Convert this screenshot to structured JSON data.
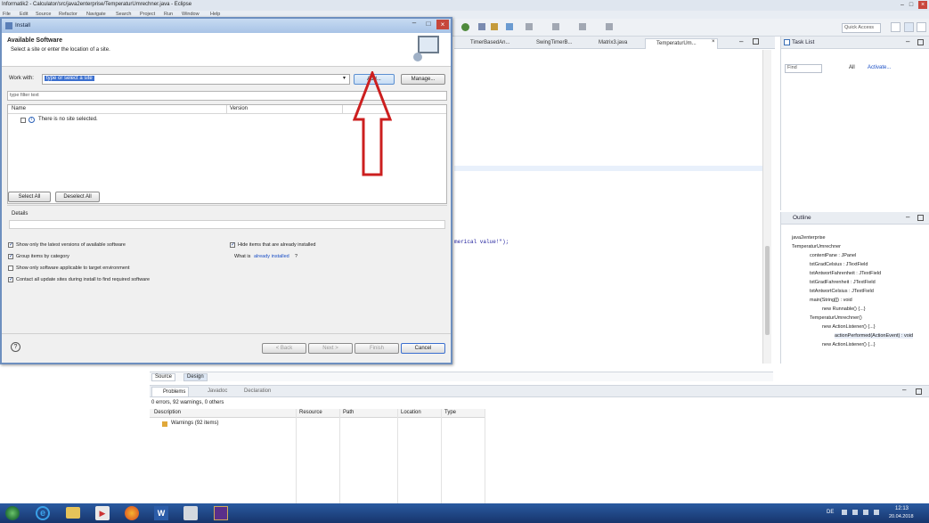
{
  "window": {
    "title": "Informatik2 - Calculator/src/java2enterprise/TemperaturUmrechner.java - Eclipse",
    "menu": [
      "File",
      "Edit",
      "Source",
      "Refactor",
      "Navigate",
      "Search",
      "Project",
      "Run",
      "Window",
      "Help"
    ],
    "quick_access": "Quick Access"
  },
  "editor": {
    "tabs": [
      "TimerBasedAn...",
      "SwingTimerB...",
      "Matrix3.java",
      "TemperaturUm..."
    ],
    "code_fragment": "merical value!\");",
    "bottom_tabs": [
      "Source",
      "Design"
    ]
  },
  "tasklist": {
    "title": "Task List",
    "find_placeholder": "Find",
    "all_label": "All",
    "activate_label": "Activate..."
  },
  "outline": {
    "title": "Outline",
    "items": [
      "java2enterprise",
      "TemperaturUmrechner",
      "contentPane : JPanel",
      "txtGradCelsius : JTextField",
      "txtAntwortFahrenheit : JTextField",
      "txtGradFahrenheit : JTextField",
      "txtAntwortCelsius : JTextField",
      "main(String[]) : void",
      "new Runnable() {...}",
      "TemperaturUmrechner()",
      "new ActionListener() {...}",
      "actionPerformed(ActionEvent) : void",
      "new ActionListener() {...}"
    ]
  },
  "problems": {
    "tabs": [
      "Problems",
      "Javadoc",
      "Declaration"
    ],
    "summary": "0 errors, 92 warnings, 0 others",
    "columns": [
      "Description",
      "Resource",
      "Path",
      "Location",
      "Type"
    ],
    "row": "Warnings (92 items)"
  },
  "dialog": {
    "title": "Install",
    "header_title": "Available Software",
    "header_subtitle": "Select a site or enter the location of a site.",
    "work_with_label": "Work with:",
    "work_with_value": "type or select a site",
    "add_button": "Add...",
    "manage_button": "Manage...",
    "filter_placeholder": "type filter text",
    "columns": [
      "Name",
      "Version"
    ],
    "no_site_text": "There is no site selected.",
    "select_all": "Select All",
    "deselect_all": "Deselect All",
    "details_label": "Details",
    "options_left": [
      {
        "label": "Show only the latest versions of available software",
        "checked": true
      },
      {
        "label": "Group items by category",
        "checked": true
      },
      {
        "label": "Show only software applicable to target environment",
        "checked": false
      },
      {
        "label": "Contact all update sites during install to find required software",
        "checked": true
      }
    ],
    "options_right": [
      {
        "label": "Hide items that are already installed",
        "checked": true
      }
    ],
    "what_is_prefix": "What is ",
    "what_is_link": "already installed",
    "what_is_suffix": "?",
    "back_button": "< Back",
    "next_button": "Next >",
    "finish_button": "Finish",
    "cancel_button": "Cancel"
  },
  "taskbar": {
    "time": "12:13",
    "date": "20.04.2018",
    "language": "DE"
  },
  "colors": {
    "annotation_arrow": "#cc1f1f",
    "selection": "#3b6fcf",
    "taskbar": "#1c3f7a",
    "link": "#1a4fc6"
  }
}
